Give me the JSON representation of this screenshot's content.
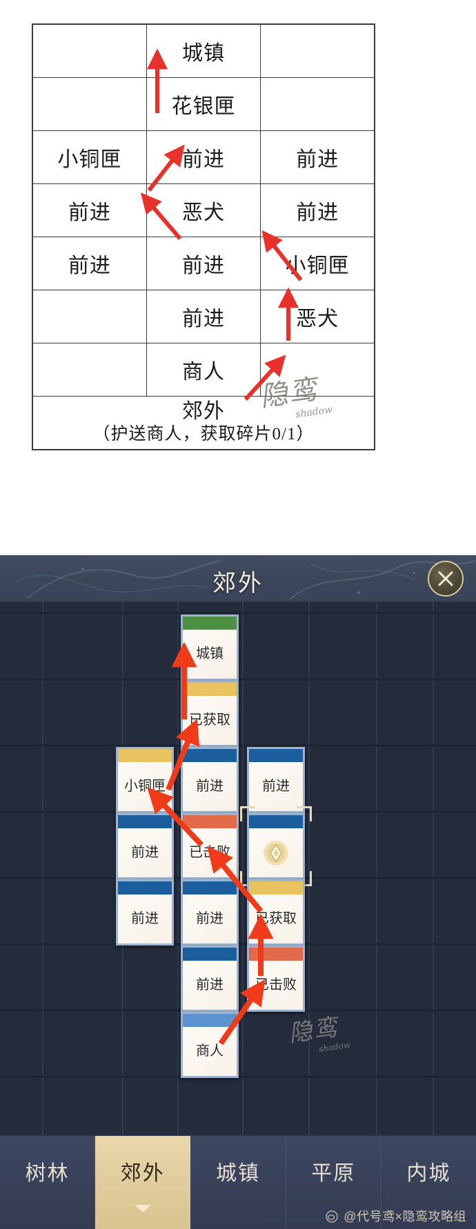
{
  "guide": {
    "rows": [
      [
        {
          "text": "",
          "fill": "empty"
        },
        {
          "text": "城镇",
          "fill": "green"
        },
        {
          "text": "",
          "fill": "empty"
        }
      ],
      [
        {
          "text": "",
          "fill": "empty"
        },
        {
          "text": "花银匣",
          "fill": "blue"
        },
        {
          "text": "",
          "fill": "empty"
        }
      ],
      [
        {
          "text": "小铜匣",
          "fill": "yellow"
        },
        {
          "text": "前进",
          "fill": "empty"
        },
        {
          "text": "前进",
          "fill": "empty"
        }
      ],
      [
        {
          "text": "前进",
          "fill": "empty"
        },
        {
          "text": "恶犬",
          "fill": "red"
        },
        {
          "text": "前进",
          "fill": "empty"
        }
      ],
      [
        {
          "text": "前进",
          "fill": "empty"
        },
        {
          "text": "前进",
          "fill": "empty"
        },
        {
          "text": "小铜匣",
          "fill": "yellow"
        }
      ],
      [
        {
          "text": "",
          "fill": "empty"
        },
        {
          "text": "前进",
          "fill": "empty"
        },
        {
          "text": "恶犬",
          "fill": "red"
        }
      ],
      [
        {
          "text": "",
          "fill": "empty"
        },
        {
          "text": "商人",
          "fill": "empty"
        },
        {
          "text": "",
          "fill": "empty"
        }
      ]
    ],
    "footer_title": "郊外",
    "footer_sub": "（护送商人，获取碎片0/1）",
    "watermark_main": "隐鸾",
    "watermark_sub": "shadow",
    "colors": {
      "green": "#dde5c2",
      "blue": "#9dc3e6",
      "yellow": "#fdf39a",
      "red": "#f1c5c5",
      "arrow": "#e8312a"
    }
  },
  "game": {
    "header": {
      "title": "郊外",
      "close_label": "×"
    },
    "cards": [
      {
        "label": "城镇",
        "cap": "green",
        "col": 2,
        "row": 1,
        "selected": false,
        "icon": ""
      },
      {
        "label": "已获取",
        "cap": "yellow",
        "col": 2,
        "row": 2,
        "selected": false,
        "icon": ""
      },
      {
        "label": "小铜匣",
        "cap": "yellow",
        "col": 1,
        "row": 3,
        "selected": false,
        "icon": ""
      },
      {
        "label": "前进",
        "cap": "blue",
        "col": 2,
        "row": 3,
        "selected": false,
        "icon": ""
      },
      {
        "label": "前进",
        "cap": "blue",
        "col": 3,
        "row": 3,
        "selected": false,
        "icon": ""
      },
      {
        "label": "前进",
        "cap": "blue",
        "col": 1,
        "row": 4,
        "selected": false,
        "icon": ""
      },
      {
        "label": "已击败",
        "cap": "red",
        "col": 2,
        "row": 4,
        "selected": false,
        "icon": ""
      },
      {
        "label": "",
        "cap": "blue",
        "col": 3,
        "row": 4,
        "selected": true,
        "icon": "diamond-icon"
      },
      {
        "label": "前进",
        "cap": "blue",
        "col": 1,
        "row": 5,
        "selected": false,
        "icon": ""
      },
      {
        "label": "前进",
        "cap": "blue",
        "col": 2,
        "row": 5,
        "selected": false,
        "icon": ""
      },
      {
        "label": "已获取",
        "cap": "yellow",
        "col": 3,
        "row": 5,
        "selected": false,
        "icon": ""
      },
      {
        "label": "前进",
        "cap": "blue",
        "col": 2,
        "row": 6,
        "selected": false,
        "icon": ""
      },
      {
        "label": "已击败",
        "cap": "red",
        "col": 3,
        "row": 6,
        "selected": false,
        "icon": ""
      },
      {
        "label": "商人",
        "cap": "lblue",
        "col": 2,
        "row": 7,
        "selected": false,
        "icon": ""
      }
    ],
    "watermark_main": "隐鸾",
    "watermark_sub": "shadow"
  },
  "tabs": [
    {
      "label": "树林",
      "active": false
    },
    {
      "label": "郊外",
      "active": true
    },
    {
      "label": "城镇",
      "active": false
    },
    {
      "label": "平原",
      "active": false
    },
    {
      "label": "内城",
      "active": false
    }
  ],
  "credit": "@代号鸢×隐鸾攻略组"
}
